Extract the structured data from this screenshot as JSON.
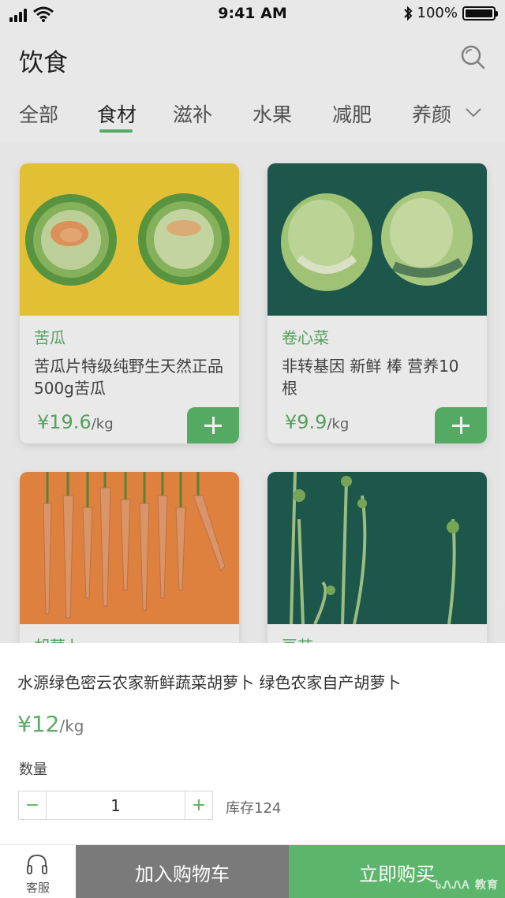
{
  "status_bar": {
    "time": "9:41 AM",
    "battery": "100%"
  },
  "header": {
    "title": "饮食"
  },
  "tabs": [
    {
      "label": "全部"
    },
    {
      "label": "食材"
    },
    {
      "label": "滋补"
    },
    {
      "label": "水果"
    },
    {
      "label": "减肥"
    },
    {
      "label": "养颜"
    }
  ],
  "products": [
    {
      "name": "苦瓜",
      "desc": "苦瓜片特级纯野生天然正品500g苦瓜",
      "price": "¥19.6",
      "unit": "/kg"
    },
    {
      "name": "卷心菜",
      "desc": "非转基因 新鲜 棒 营养10根",
      "price": "¥9.9",
      "unit": "/kg"
    },
    {
      "name": "胡萝卜"
    },
    {
      "name": "豆苗"
    }
  ],
  "sheet": {
    "title": "水源绿色密云农家新鲜蔬菜胡萝卜 绿色农家自产胡萝卜",
    "price": "¥12",
    "unit": "/kg",
    "qty_label": "数量",
    "qty_value": "1",
    "stock": "库存124"
  },
  "bottom_bar": {
    "service_label": "客服",
    "cart_label": "加入购物车",
    "buy_label": "立即购买"
  },
  "watermark": "ᏖᏁᏁᎪ 教育",
  "colors": {
    "accent": "#5bb56a",
    "cart_button": "#7a7a7a"
  }
}
